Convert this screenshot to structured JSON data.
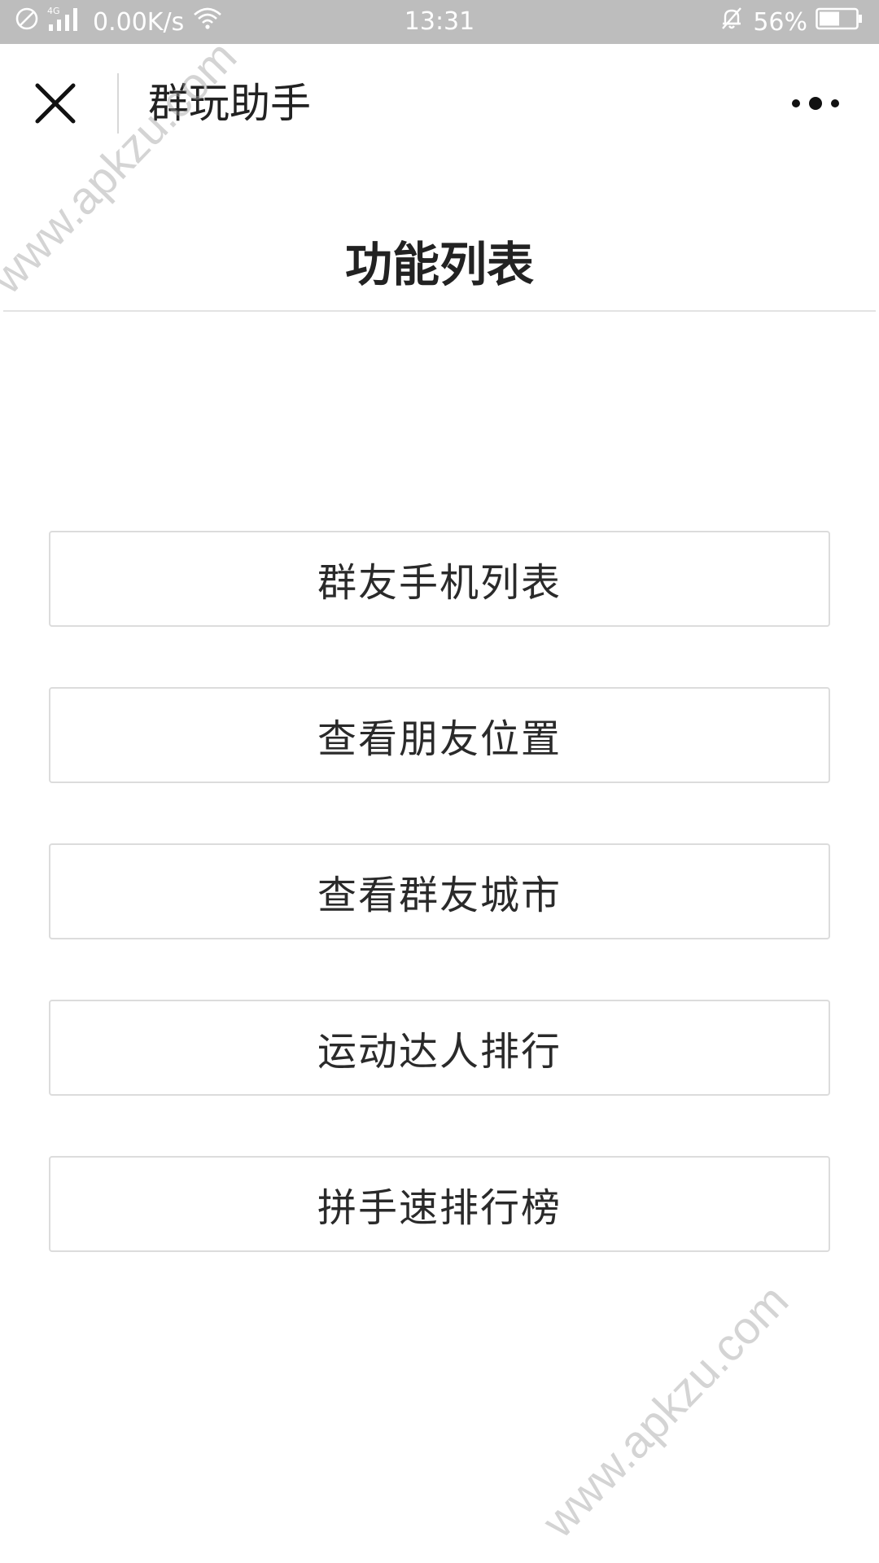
{
  "status_bar": {
    "network_type": "4G",
    "speed": "0.00K/s",
    "time": "13:31",
    "battery": "56%",
    "battery_level": 0.56
  },
  "nav": {
    "title": "群玩助手"
  },
  "page": {
    "title": "功能列表"
  },
  "functions": [
    {
      "label": "群友手机列表"
    },
    {
      "label": "查看朋友位置"
    },
    {
      "label": "查看群友城市"
    },
    {
      "label": "运动达人排行"
    },
    {
      "label": "拼手速排行榜"
    }
  ],
  "watermarks": [
    {
      "text": "www.apkzu.com"
    },
    {
      "text": "www.apkzu.com"
    }
  ],
  "colors": {
    "status_bar_bg": "#bdbdbd",
    "text_primary": "#222222",
    "button_border": "#dcdcdc"
  }
}
